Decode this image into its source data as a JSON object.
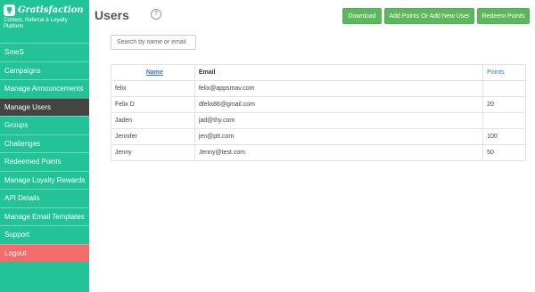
{
  "brand": {
    "name": "Gratisfaction",
    "tagline": "Contest, Referral & Loyalty Platform"
  },
  "sidebar": {
    "items": [
      {
        "label": "SmeS"
      },
      {
        "label": "Campaigns"
      },
      {
        "label": "Manage Announcements"
      },
      {
        "label": "Manage Users"
      },
      {
        "label": "Groups"
      },
      {
        "label": "Challenges"
      },
      {
        "label": "Redeemed Points"
      },
      {
        "label": "Manage Loyalty Rewards"
      },
      {
        "label": "API Details"
      },
      {
        "label": "Manage Email Templates"
      },
      {
        "label": "Support"
      },
      {
        "label": "Logout"
      }
    ]
  },
  "main": {
    "title": "Users",
    "help": "?",
    "buttons": {
      "download": "Download",
      "add_points": "Add Points Or Add New User",
      "redeem": "Redeem Points"
    },
    "search": {
      "placeholder": "Search by name or email",
      "value": ""
    },
    "table": {
      "headers": {
        "name": "Name",
        "email": "Email",
        "points": "Points"
      },
      "rows": [
        {
          "name": "felix",
          "email": "felix@appsmav.com",
          "points": ""
        },
        {
          "name": "Felix D",
          "email": "dfelix86@gmail.com",
          "points": "20"
        },
        {
          "name": "Jaden",
          "email": "jad@thy.com",
          "points": ""
        },
        {
          "name": "Jennifer",
          "email": "jen@ptt.com",
          "points": "100"
        },
        {
          "name": "Jenny",
          "email": "Jenny@test.com",
          "points": "50"
        }
      ]
    }
  },
  "colors": {
    "sidebar": "#22c497",
    "active_item": "#444444",
    "logout": "#f26c6c",
    "button": "#5cb85c",
    "link": "#337ab7"
  }
}
